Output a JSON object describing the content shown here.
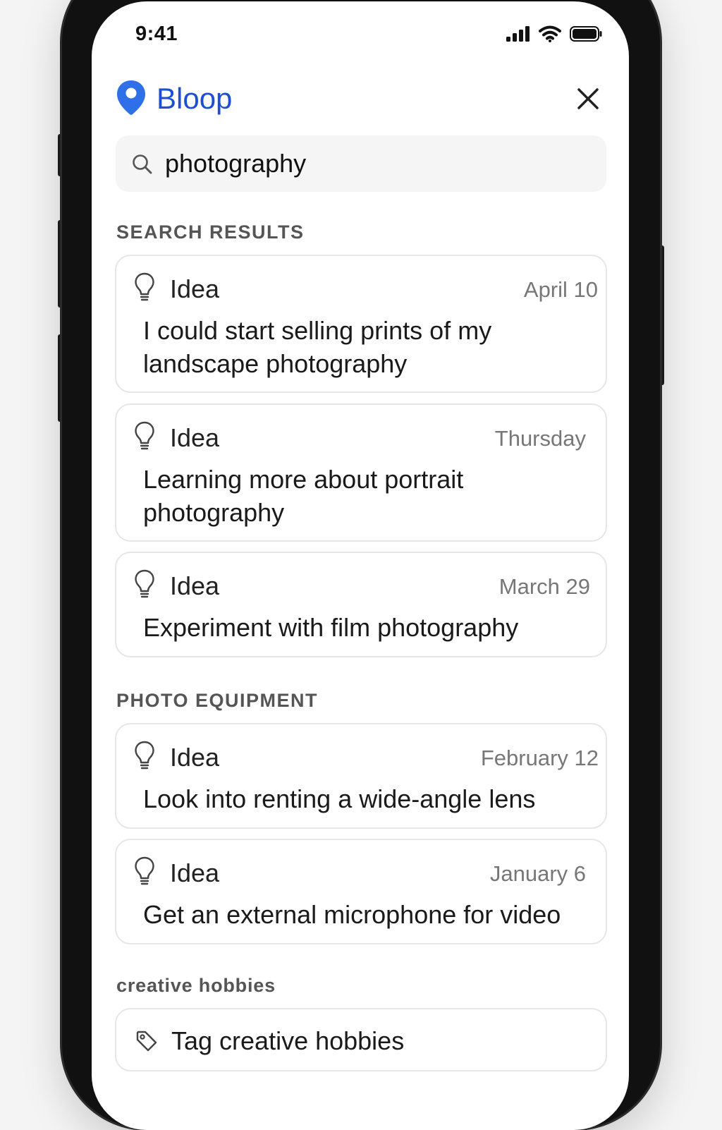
{
  "status_bar": {
    "time": "9:41"
  },
  "app": {
    "name": "Bloop",
    "brand_color": "#2f6fe8"
  },
  "search": {
    "value": "photography"
  },
  "sections": [
    {
      "label": "SEARCH RESULTS",
      "items": [
        {
          "type": "Idea",
          "date": "April 10",
          "text": "I could start selling prints of my landscape photography"
        },
        {
          "type": "Idea",
          "date": "Thursday",
          "text": "Learning more about portrait photography"
        },
        {
          "type": "Idea",
          "date": "March 29",
          "text": "Experiment with film photography"
        }
      ]
    },
    {
      "label": "PHOTO EQUIPMENT",
      "items": [
        {
          "type": "Idea",
          "date": "February 12",
          "text": "Look into renting a wide-angle lens"
        },
        {
          "type": "Idea",
          "date": "January 6",
          "text": "Get an external microphone for video"
        }
      ]
    },
    {
      "label": "creative hobbies",
      "items": [
        {
          "text": "Tag creative hobbies"
        }
      ]
    }
  ],
  "icons": {
    "logo": "location-pin-icon",
    "close": "close-icon",
    "search": "search-icon",
    "idea": "lightbulb-icon",
    "tag": "tag-icon"
  }
}
